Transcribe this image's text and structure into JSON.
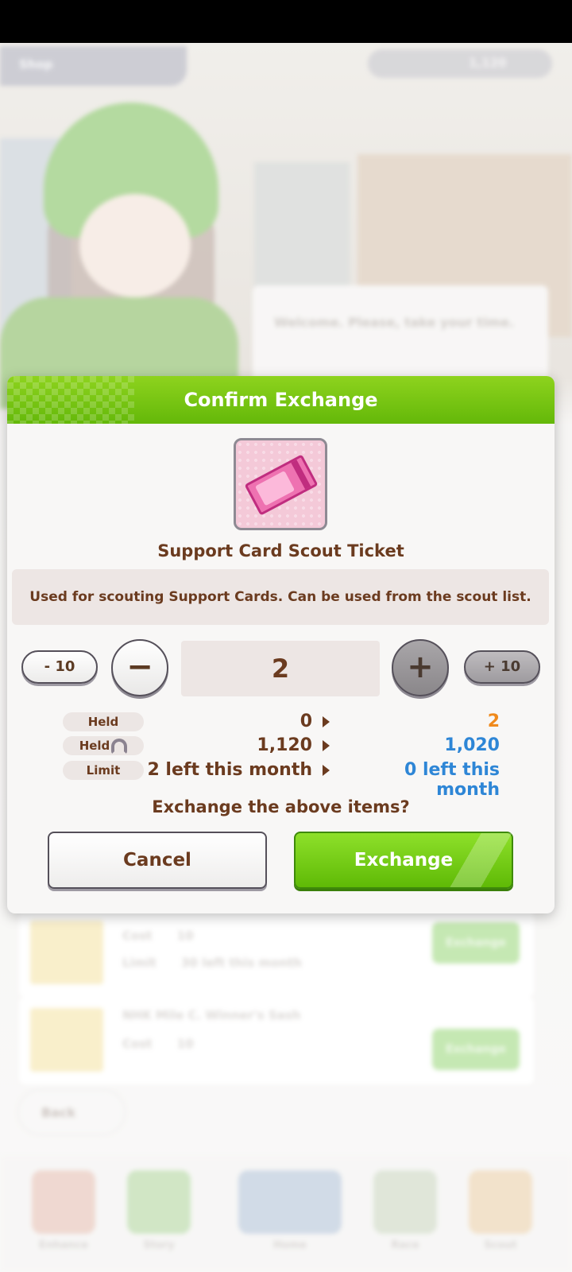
{
  "background": {
    "shop_tab_label": "Shop",
    "currency_value": "1,120",
    "speech_text": "Welcome. Please, take your time.",
    "list_items": [
      {
        "title": "",
        "cost_label": "Cost",
        "cost_value": "10",
        "limit_label": "Limit",
        "limit_value": "30 left this month",
        "button_label": "Exchange"
      },
      {
        "title": "NHK Mile C. Winner's Sash",
        "cost_label": "Cost",
        "cost_value": "10",
        "button_label": "Exchange"
      }
    ],
    "back_label": "Back",
    "nav_items": [
      "Enhance",
      "Story",
      "Home",
      "Race",
      "Scout"
    ]
  },
  "dialog": {
    "title": "Confirm Exchange",
    "item_name": "Support Card Scout Ticket",
    "item_icon": "support-card-ticket-icon",
    "description": "Used for scouting Support Cards. Can be used from the scout list.",
    "quantity": {
      "minus10_label": "- 10",
      "minus_label": "−",
      "value": "2",
      "plus_label": "+",
      "plus10_label": "+ 10"
    },
    "rows": [
      {
        "label": "Held",
        "current": "0",
        "after": "2",
        "after_color": "#f08a1c"
      },
      {
        "label": "Held",
        "icon": "horseshoe-icon",
        "current": "1,120",
        "after": "1,020",
        "after_color": "#2e86d6"
      },
      {
        "label": "Limit",
        "current": "2 left this month",
        "after": "0 left this month",
        "after_color": "#2e86d6"
      }
    ],
    "question": "Exchange the above items?",
    "cancel_label": "Cancel",
    "exchange_label": "Exchange"
  },
  "colors": {
    "header_green": "#64b809",
    "text_brown": "#6b3b1f",
    "accent_orange": "#f08a1c",
    "accent_blue": "#2e86d6"
  }
}
